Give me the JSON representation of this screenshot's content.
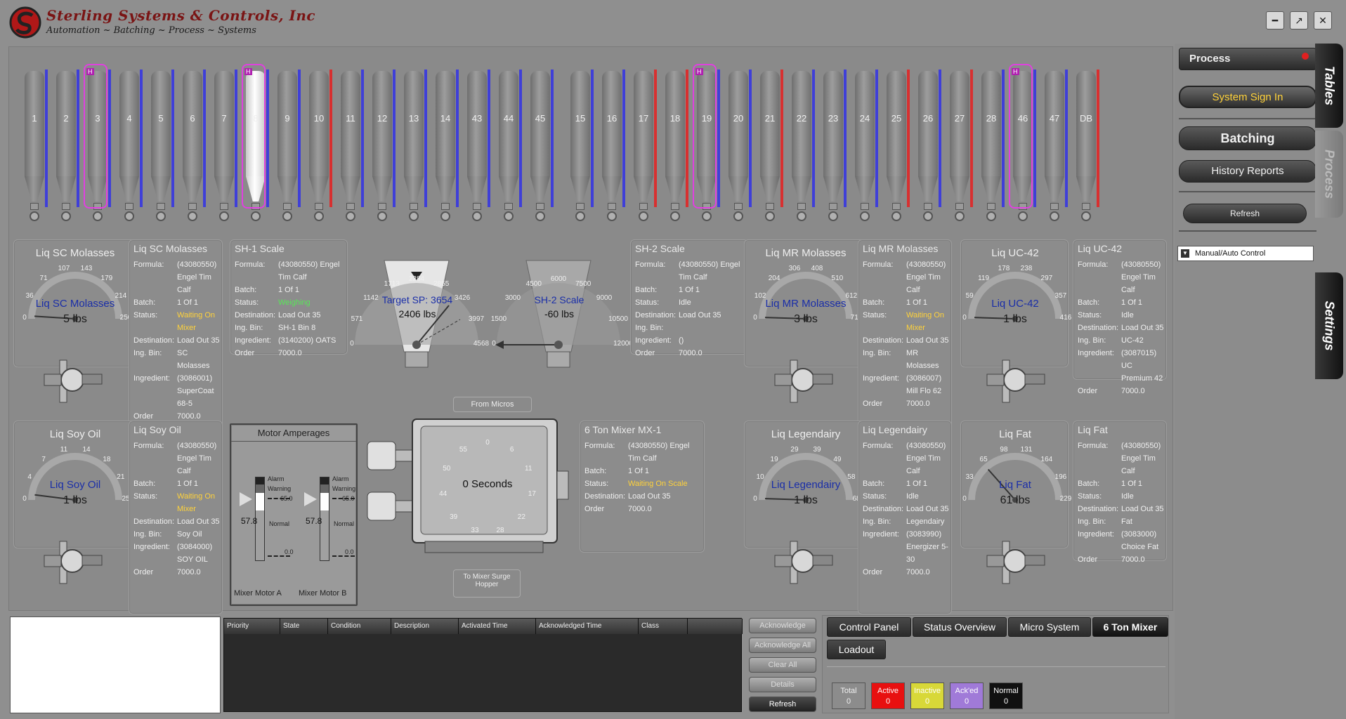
{
  "header": {
    "company": "Sterling Systems & Controls, Inc",
    "tagline": "Automation ~ Batching ~ Process ~ Systems",
    "window_buttons": [
      "minimize-icon",
      "restore-icon",
      "close-icon"
    ]
  },
  "bins": [
    {
      "label": "1",
      "level": "blue"
    },
    {
      "label": "2",
      "level": "blue"
    },
    {
      "label": "3",
      "level": "blue",
      "hi": true
    },
    {
      "label": "4",
      "level": "blue"
    },
    {
      "label": "5",
      "level": "blue"
    },
    {
      "label": "6",
      "level": "blue"
    },
    {
      "label": "7",
      "level": "blue"
    },
    {
      "label": "8",
      "level": "blue",
      "hi": true,
      "selected": true
    },
    {
      "label": "9",
      "level": "blue"
    },
    {
      "label": "10",
      "level": "red"
    },
    {
      "label": "11",
      "level": "blue"
    },
    {
      "label": "12",
      "level": "blue"
    },
    {
      "label": "13",
      "level": "blue"
    },
    {
      "label": "14",
      "level": "blue"
    },
    {
      "label": "43",
      "level": "blue"
    },
    {
      "label": "44",
      "level": "blue"
    },
    {
      "label": "45",
      "level": "blue"
    },
    {
      "label": "15",
      "level": "blue"
    },
    {
      "label": "16",
      "level": "blue"
    },
    {
      "label": "17",
      "level": "red"
    },
    {
      "label": "18",
      "level": "red"
    },
    {
      "label": "19",
      "level": "blue",
      "hi": true
    },
    {
      "label": "20",
      "level": "blue"
    },
    {
      "label": "21",
      "level": "red"
    },
    {
      "label": "22",
      "level": "blue"
    },
    {
      "label": "23",
      "level": "blue"
    },
    {
      "label": "24",
      "level": "blue"
    },
    {
      "label": "25",
      "level": "red"
    },
    {
      "label": "26",
      "level": "blue"
    },
    {
      "label": "27",
      "level": "red"
    },
    {
      "label": "28",
      "level": "blue"
    },
    {
      "label": "46",
      "level": "blue",
      "hi": true
    },
    {
      "label": "47",
      "level": "blue"
    },
    {
      "label": "DB",
      "level": "red"
    }
  ],
  "bin_hi_mark": "H",
  "labels": {
    "k_formula": "Formula:",
    "k_batch": "Batch:",
    "k_status": "Status:",
    "k_dest": "Destination:",
    "k_ing": "Ing. Bin:",
    "k_ingr": "Ingredient:",
    "k_order": "Order"
  },
  "liq_sc": {
    "title": "Liq SC Molasses",
    "gauge_name": "Liq SC Molasses",
    "value": "5 lbs",
    "ticks": [
      "0",
      "36",
      "71",
      "107",
      "143",
      "179",
      "214",
      "250"
    ],
    "info_title": "Liq SC Molasses",
    "formula": "(43080550) Engel Tim Calf",
    "batch": "1 Of 1",
    "status": "Waiting On Mixer",
    "dest": "Load Out 35",
    "ing_bin": "SC Molasses",
    "ingredient": "(3086001) SuperCoat 68-5",
    "order": "7000.0"
  },
  "sh1": {
    "title": "SH-1 Scale",
    "formula": "(43080550) Engel Tim Calf",
    "batch": "1 Of 1",
    "status": "Weighing",
    "dest": "Load Out 35",
    "ing_bin": "SH-1 Bin 8",
    "ingredient": "(3140200) OATS",
    "order": "7000.0",
    "target": "Target SP: 3654",
    "value": "2406 lbs",
    "ticks": [
      "0",
      "571",
      "1142",
      "1713",
      "2284",
      "2855",
      "3426",
      "3997",
      "4568"
    ]
  },
  "sh2": {
    "title": "SH-2 Scale",
    "formula": "(43080550) Engel Tim Calf",
    "batch": "1 Of 1",
    "status": "Idle",
    "dest": "Load Out 35",
    "ing_bin": "",
    "ingredient": "()",
    "order": "7000.0",
    "name": "SH-2 Scale",
    "value": "-60 lbs",
    "ticks": [
      "0",
      "1500",
      "3000",
      "4500",
      "6000",
      "7500",
      "9000",
      "10500",
      "12000"
    ]
  },
  "liq_mr": {
    "title": "Liq MR Molasses",
    "gauge_name": "Liq MR Molasses",
    "value": "3 lbs",
    "ticks": [
      "0",
      "102",
      "204",
      "306",
      "408",
      "510",
      "612",
      "714"
    ],
    "info_title": "Liq MR Molasses",
    "formula": "(43080550) Engel Tim Calf",
    "batch": "1 Of 1",
    "status": "Waiting On Mixer",
    "dest": "Load Out 35",
    "ing_bin": "MR Molasses",
    "ingredient": "(3086007) Mill Flo 62",
    "order": "7000.0"
  },
  "liq_uc": {
    "title": "Liq UC-42",
    "gauge_name": "Liq UC-42",
    "value": "1 lbs",
    "ticks": [
      "0",
      "59",
      "119",
      "178",
      "238",
      "297",
      "357",
      "416"
    ],
    "info_title": "Liq UC-42",
    "formula": "(43080550) Engel Tim Calf",
    "batch": "1 Of 1",
    "status": "Idle",
    "dest": "Load Out 35",
    "ing_bin": "UC-42",
    "ingredient": "(3087015) UC Premium 42",
    "order": "7000.0"
  },
  "liq_soy": {
    "title": "Liq Soy Oil",
    "gauge_name": "Liq Soy Oil",
    "value": "1 lbs",
    "ticks": [
      "0",
      "4",
      "7",
      "11",
      "14",
      "18",
      "21",
      "25"
    ],
    "info_title": "Liq Soy Oil",
    "formula": "(43080550) Engel Tim Calf",
    "batch": "1 Of 1",
    "status": "Waiting On Mixer",
    "dest": "Load Out 35",
    "ing_bin": "Soy Oil",
    "ingredient": "(3084000) SOY OIL",
    "order": "7000.0"
  },
  "motor": {
    "title": "Motor Amperages",
    "alarm": "Alarm",
    "warning": "Warning",
    "normal": "Normal",
    "high": "65.0",
    "low": "0.0",
    "a_value": "57.8",
    "b_value": "57.8",
    "a_label": "Mixer Motor A",
    "b_label": "Mixer Motor B",
    "a_level": 0.89,
    "b_level": 0.89
  },
  "mixer": {
    "from_micros": "From Micros",
    "to_surge": "To Mixer Surge Hopper",
    "timer": "0 Seconds",
    "dial": [
      "0",
      "6",
      "11",
      "17",
      "22",
      "28",
      "33",
      "39",
      "44",
      "50",
      "55"
    ]
  },
  "mx1": {
    "title": "6 Ton Mixer MX-1",
    "formula": "(43080550) Engel Tim Calf",
    "batch": "1 Of 1",
    "status": "Waiting On Scale",
    "dest": "Load Out 35",
    "order": "7000.0"
  },
  "liq_leg": {
    "title": "Liq Legendairy",
    "gauge_name": "Liq Legendairy",
    "value": "1 lbs",
    "ticks": [
      "0",
      "10",
      "19",
      "29",
      "39",
      "49",
      "58",
      "68"
    ],
    "info_title": "Liq Legendairy",
    "formula": "(43080550) Engel Tim Calf",
    "batch": "1 Of 1",
    "status": "Idle",
    "dest": "Load Out 35",
    "ing_bin": "Legendairy",
    "ingredient": "(3083990) Energizer 5-30",
    "order": "7000.0"
  },
  "liq_fat": {
    "title": "Liq Fat",
    "gauge_name": "Liq Fat",
    "value": "61 lbs",
    "ticks": [
      "0",
      "33",
      "65",
      "98",
      "131",
      "164",
      "196",
      "229"
    ],
    "info_title": "Liq Fat",
    "formula": "(43080550) Engel Tim Calf",
    "batch": "1 Of 1",
    "status": "Idle",
    "dest": "Load Out 35",
    "ing_bin": "Fat",
    "ingredient": "(3083000) Choice Fat",
    "order": "7000.0"
  },
  "alarms": {
    "columns": [
      "Priority",
      "State",
      "Condition",
      "Description",
      "Activated Time",
      "Acknowledged Time",
      "Class",
      ""
    ],
    "buttons": [
      "Acknowledge",
      "Acknowledge All",
      "Clear All",
      "Details",
      "Refresh"
    ]
  },
  "tabs": [
    "Control Panel",
    "Status Overview",
    "Micro System",
    "6 Ton Mixer",
    "Loadout"
  ],
  "stats": [
    {
      "label": "Total",
      "value": "0",
      "bg": "#8c8c8c",
      "fg": "#f0f0f0"
    },
    {
      "label": "Active",
      "value": "0",
      "bg": "#e81010",
      "fg": "#ffffff"
    },
    {
      "label": "Inactive",
      "value": "0",
      "bg": "#d8d838",
      "fg": "#ffffff"
    },
    {
      "label": "Ack'ed",
      "value": "0",
      "bg": "#a07ad8",
      "fg": "#ffffff"
    },
    {
      "label": "Normal",
      "value": "0",
      "bg": "#111111",
      "fg": "#ffffff"
    }
  ],
  "sidebar": {
    "process": "Process",
    "sign_in": "System Sign In",
    "batching": "Batching",
    "history": "History Reports",
    "refresh": "Refresh",
    "manual_auto": "Manual/Auto Control",
    "vtabs": [
      "Tables",
      "Process",
      "Settings"
    ]
  },
  "colors": {
    "level_blue": "#3f3fd8",
    "level_red": "#d83030",
    "accent_yellow": "#ffd23a",
    "gauge_name": "#1a2ea8"
  }
}
